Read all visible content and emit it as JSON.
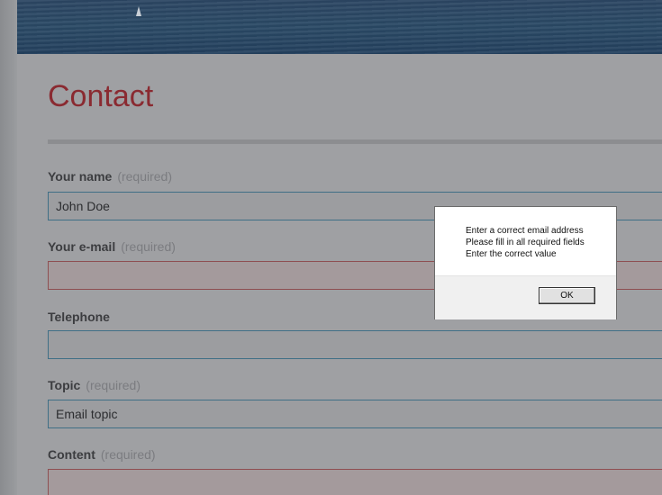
{
  "page": {
    "title": "Contact"
  },
  "form": {
    "required_hint": "(required)",
    "fields": [
      {
        "label": "Your name",
        "required": true,
        "value": "John Doe",
        "state": "valid"
      },
      {
        "label": "Your e-mail",
        "required": true,
        "value": "",
        "state": "error"
      },
      {
        "label": "Telephone",
        "required": false,
        "value": "",
        "state": "valid"
      },
      {
        "label": "Topic",
        "required": true,
        "value": "Email topic",
        "state": "valid"
      },
      {
        "label": "Content",
        "required": true,
        "value": "",
        "state": "error"
      }
    ]
  },
  "dialog": {
    "messages": [
      "Enter a correct email address",
      "Please fill in all required fields",
      "Enter the correct value"
    ],
    "ok_label": "OK"
  },
  "colors": {
    "title": "#8a2a31",
    "overlay": "#8e9093",
    "valid_border": "#3f6f86",
    "error_border": "#8e4f52"
  }
}
